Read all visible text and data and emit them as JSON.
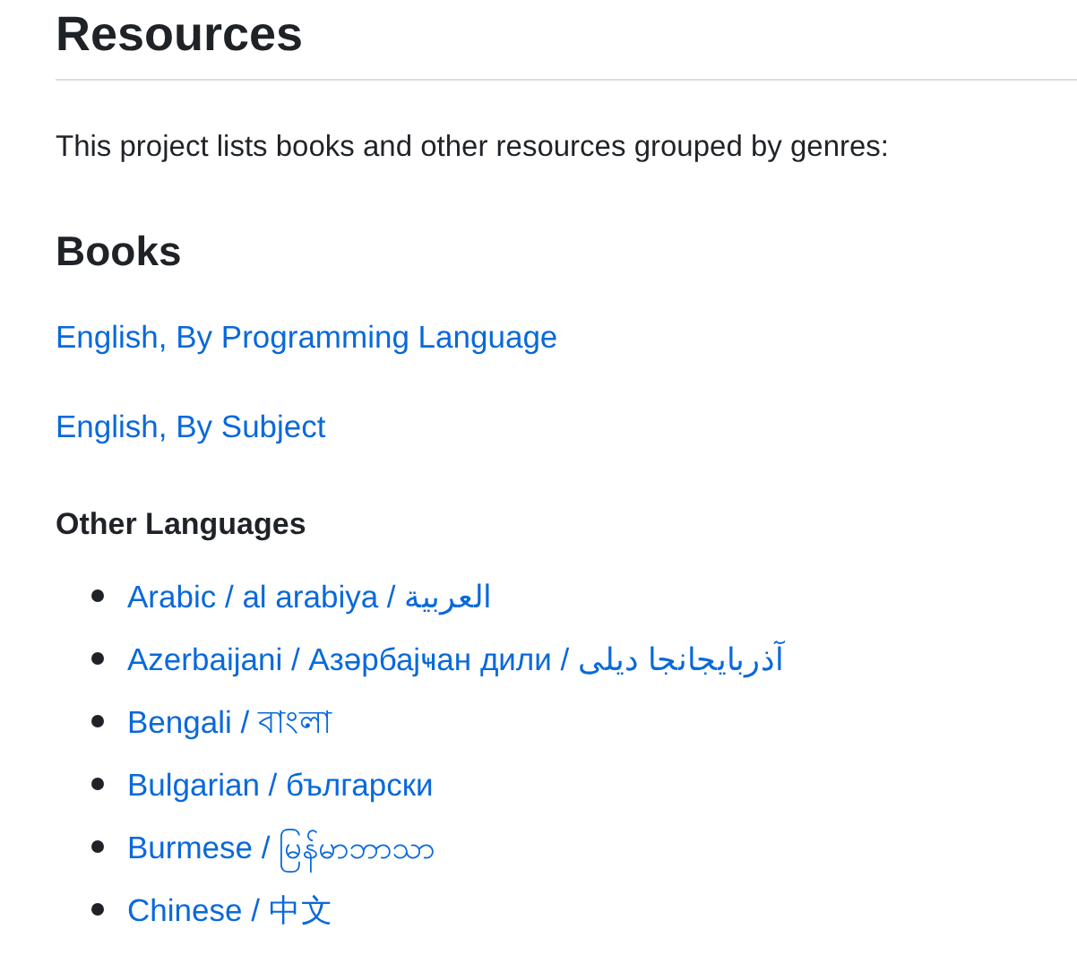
{
  "title": "Resources",
  "intro": "This project lists books and other resources grouped by genres:",
  "books": {
    "heading": "Books",
    "links": [
      "English, By Programming Language",
      "English, By Subject"
    ]
  },
  "other_languages": {
    "heading": "Other Languages",
    "items": [
      {
        "label": "Arabic / al arabiya / العربية"
      },
      {
        "label": "Azerbaijani / Азәрбајҹан дили / آذربایجانجا دیلی"
      },
      {
        "label": "Bengali / বাংলা"
      },
      {
        "label": "Bulgarian / български"
      },
      {
        "label": "Burmese / မြန်မာဘာသာ"
      },
      {
        "label": "Chinese / 中文"
      }
    ]
  }
}
